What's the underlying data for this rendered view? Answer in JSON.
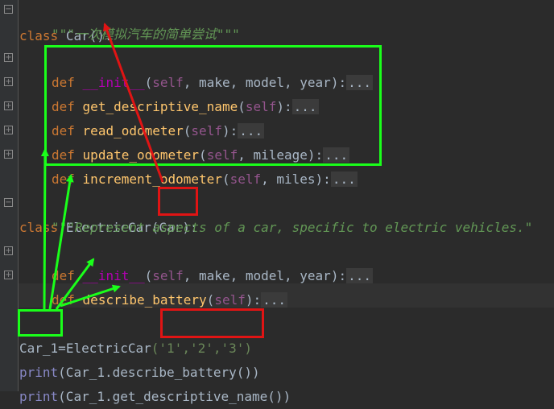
{
  "code": {
    "line1": {
      "kw": "class",
      "name": "Car",
      "rest": "():"
    },
    "line2": {
      "doc": "\"\"\"一次模拟汽车的简单尝试\"\"\""
    },
    "line3": {
      "kw": "def",
      "fn": "__init__",
      "open": "(",
      "self": "self",
      "params": ", make, model, year",
      "close": "):",
      "ellipsis": "..."
    },
    "line4": {
      "kw": "def",
      "fn": "get_descriptive_name",
      "open": "(",
      "self": "self",
      "close": "):",
      "ellipsis": "..."
    },
    "line5": {
      "kw": "def",
      "fn": "read_odometer",
      "open": "(",
      "self": "self",
      "close": "):",
      "ellipsis": "..."
    },
    "line6": {
      "kw": "def",
      "fn": "update_odometer",
      "open": "(",
      "self": "self",
      "params": ", mileage",
      "close": "):",
      "ellipsis": "..."
    },
    "line7": {
      "kw": "def",
      "fn": "increment_odometer",
      "open": "(",
      "self": "self",
      "params": ", miles",
      "close": "):",
      "ellipsis": "..."
    },
    "line8": {
      "kw": "class",
      "name": "ElectricCar",
      "parent": "(Car)",
      "rest": ":"
    },
    "line9": {
      "doc": "\"\"\"Represent aspects of a car, specific to electric vehicles.\""
    },
    "line10": {
      "kw": "def",
      "fn": "__init__",
      "open": "(",
      "self": "self",
      "params": ", make, model, year",
      "close": "):",
      "ellipsis": "..."
    },
    "line11": {
      "kw": "def",
      "fn": "describe_battery",
      "open": "(",
      "self": "self",
      "close": "):",
      "ellipsis": "..."
    },
    "line12": {
      "var": "Car_1",
      "eq": "=",
      "call": "ElectricCar",
      "args": "('1','2','3')"
    },
    "line13": {
      "fn": "print",
      "rest": "(Car_1.describe_battery())"
    },
    "line14": {
      "fn": "print",
      "rest": "(Car_1.get_descriptive_name())"
    }
  },
  "colors": {
    "background": "#2b2b2b",
    "keyword": "#cc7832",
    "function": "#ffc66d",
    "self": "#94558d",
    "docstring": "#629755",
    "annotation_green": "#1aff1a",
    "annotation_red": "#e01414"
  },
  "icons": {
    "fold": "fold-plus-icon"
  }
}
